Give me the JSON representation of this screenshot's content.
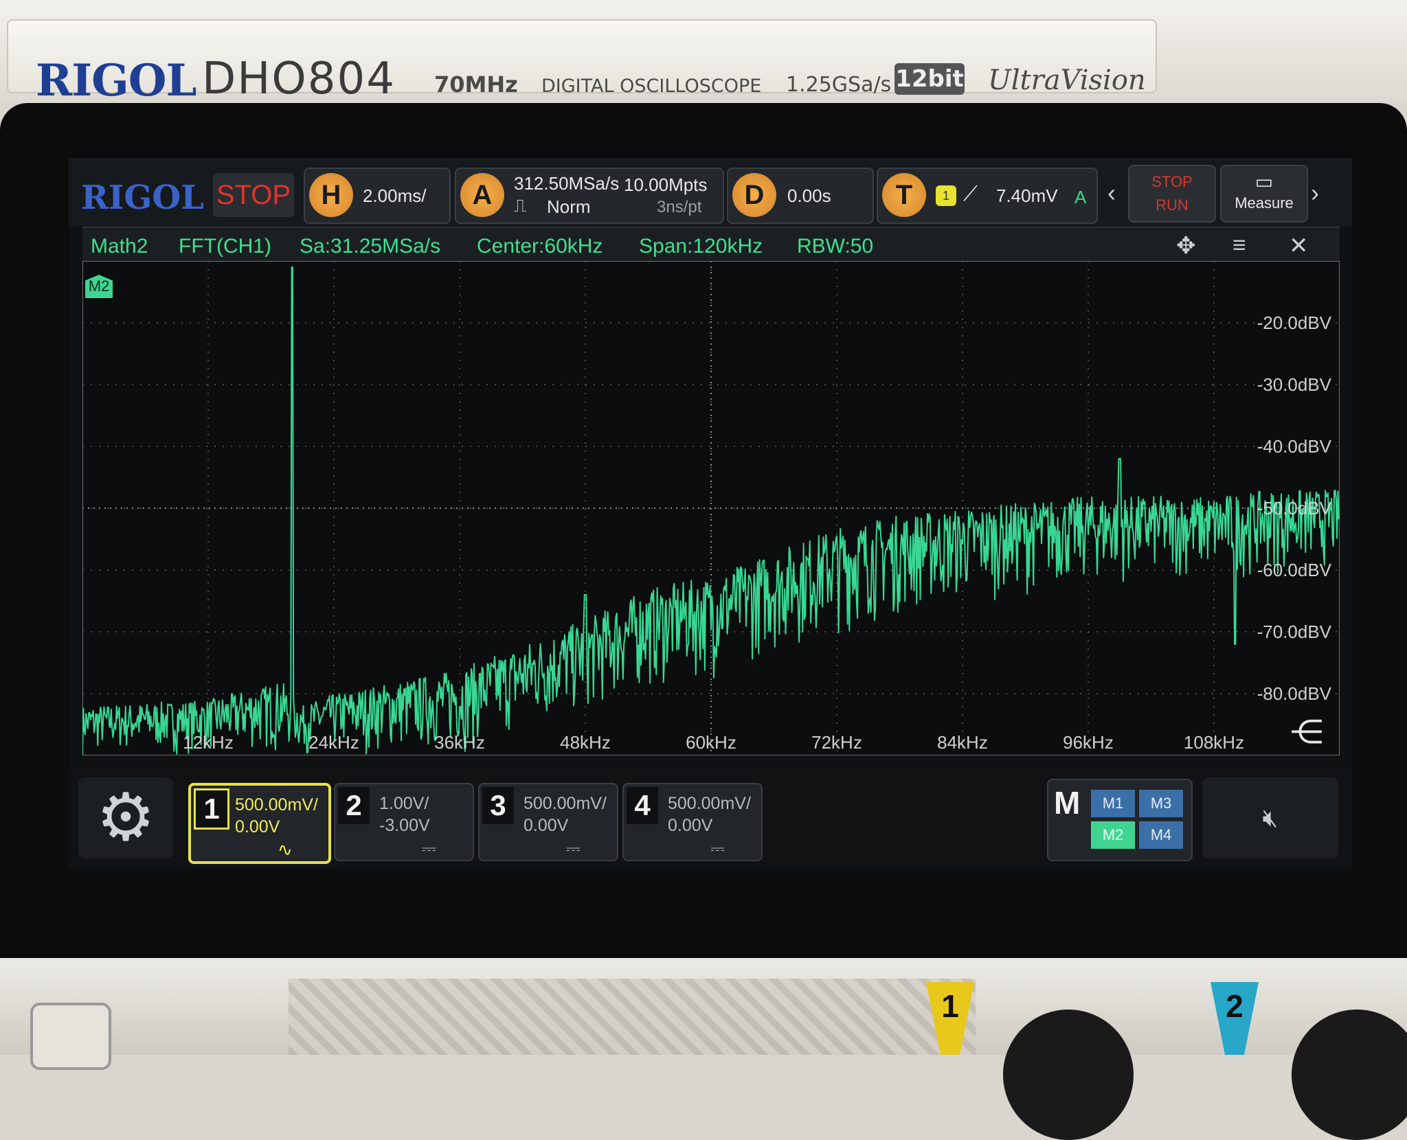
{
  "instrument": {
    "brand": "RIGOL",
    "model": "DHO804",
    "bandwidth": "70MHz",
    "description": "DIGITAL OSCILLOSCOPE",
    "sample_rate": "1.25GSa/s",
    "bits": "12bit",
    "series": "UltraVision",
    "front_channel_tags": [
      "1",
      "2"
    ]
  },
  "toolbar": {
    "logo": "RIGOL",
    "run_state": "STOP",
    "horizontal": {
      "badge": "H",
      "value": "2.00ms/"
    },
    "acquire": {
      "badge": "A",
      "rate": "312.50MSa/s",
      "depth": "10.00Mpts",
      "mode": "Norm",
      "resolution": "3ns/pt"
    },
    "delay": {
      "badge": "D",
      "value": "0.00s"
    },
    "trigger": {
      "badge": "T",
      "source": "1",
      "slope_icon": "rising-edge-icon",
      "level": "7.40mV",
      "mode": "A"
    },
    "run_button": {
      "line1": "STOP",
      "line2": "RUN"
    },
    "measure_button": {
      "label": "Measure",
      "icon": "ruler-icon"
    },
    "nav_left": "‹",
    "nav_right": "›"
  },
  "fft_header": {
    "source": "Math2",
    "function": "FFT(CH1)",
    "sample_rate": "Sa:31.25MSa/s",
    "center": "Center:60kHz",
    "span": "Span:120kHz",
    "rbw": "RBW:50",
    "icons": [
      "move-icon",
      "menu-icon",
      "close-icon"
    ]
  },
  "plot": {
    "marker_label": "M2",
    "trace_color": "#38d894",
    "grid_color": "#5b6064",
    "text_color": "#d0d0d0",
    "collapse_icon": "collapse-menu-icon"
  },
  "chart_data": {
    "type": "line",
    "title": "",
    "xlabel": "",
    "ylabel": "",
    "x_unit": "kHz",
    "y_unit": "dBV",
    "xlim": [
      0,
      120
    ],
    "ylim": [
      -90,
      -10
    ],
    "x_ticks": [
      {
        "value": 12,
        "label": "12kHz"
      },
      {
        "value": 24,
        "label": "24kHz"
      },
      {
        "value": 36,
        "label": "36kHz"
      },
      {
        "value": 48,
        "label": "48kHz"
      },
      {
        "value": 60,
        "label": "60kHz"
      },
      {
        "value": 72,
        "label": "72kHz"
      },
      {
        "value": 84,
        "label": "84kHz"
      },
      {
        "value": 96,
        "label": "96kHz"
      },
      {
        "value": 108,
        "label": "108kHz"
      }
    ],
    "y_ticks": [
      {
        "value": -20,
        "label": "-20.0dBV"
      },
      {
        "value": -30,
        "label": "-30.0dBV"
      },
      {
        "value": -40,
        "label": "-40.0dBV"
      },
      {
        "value": -50,
        "label": "-50.0dBV"
      },
      {
        "value": -60,
        "label": "-60.0dBV"
      },
      {
        "value": -70,
        "label": "-70.0dBV"
      },
      {
        "value": -80,
        "label": "-80.0dBV"
      }
    ],
    "grid": true,
    "series": [
      {
        "color": "#38d894",
        "peaks": [
          {
            "x": 20,
            "y": -11
          },
          {
            "x": 99,
            "y": -42
          },
          {
            "x": 48,
            "y": -64
          },
          {
            "x": 110,
            "y": -72
          }
        ],
        "envelope_x": [
          0,
          12,
          19,
          21,
          24,
          36,
          42,
          48,
          54,
          60,
          66,
          72,
          78,
          84,
          90,
          96,
          102,
          108,
          114,
          120
        ],
        "envelope_top_y": [
          -82,
          -81,
          -78,
          -82,
          -80,
          -76,
          -72,
          -68,
          -63,
          -61,
          -57,
          -53,
          -51,
          -50,
          -49,
          -48,
          -48,
          -48,
          -47,
          -47
        ],
        "envelope_floor_y": [
          -90,
          -90,
          -90,
          -90,
          -90,
          -90,
          -87,
          -84,
          -80,
          -78,
          -74,
          -71,
          -68,
          -66,
          -64,
          -63,
          -62,
          -62,
          -61,
          -60
        ]
      }
    ]
  },
  "statusbar": {
    "settings_icon": "gear-icon",
    "channels": [
      {
        "num": "1",
        "scale": "500.00mV/",
        "offset": "0.00V",
        "coupling": "∿",
        "active": true
      },
      {
        "num": "2",
        "scale": "1.00V/",
        "offset": "-3.00V",
        "coupling": "⎓",
        "active": false
      },
      {
        "num": "3",
        "scale": "500.00mV/",
        "offset": "0.00V",
        "coupling": "⎓",
        "active": false
      },
      {
        "num": "4",
        "scale": "500.00mV/",
        "offset": "0.00V",
        "coupling": "⎓",
        "active": false
      }
    ],
    "math": {
      "label": "M",
      "cells": [
        "M1",
        "M3",
        "M2",
        "M4"
      ],
      "active": "M2"
    },
    "mute_icon": "speaker-mute-icon"
  }
}
